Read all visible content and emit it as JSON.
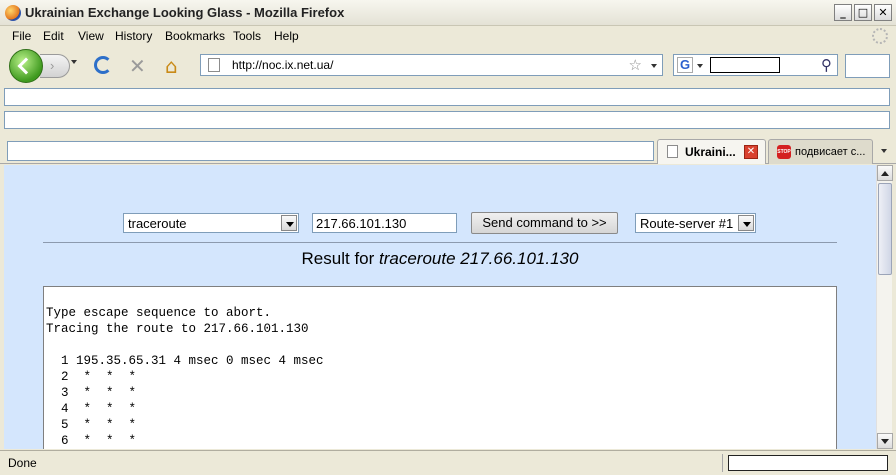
{
  "window": {
    "title": "Ukrainian Exchange Looking Glass - Mozilla Firefox",
    "buttons": {
      "minimize": "_",
      "maximize": "□",
      "close": "✕"
    }
  },
  "menu": [
    "File",
    "Edit",
    "View",
    "History",
    "Bookmarks",
    "Tools",
    "Help"
  ],
  "nav": {
    "forward_glyph": "›",
    "stop_glyph": "✕",
    "home_glyph": "⌂",
    "url": "http://noc.ix.net.ua/",
    "star_glyph": "☆",
    "search_engine": "G",
    "search_glyph": "⚲"
  },
  "tabs": [
    {
      "label": "Ukraini...",
      "close_glyph": "✕",
      "active": true
    },
    {
      "label": "подвисает с...",
      "icon_text": "STOP",
      "active": false
    }
  ],
  "form": {
    "command": "traceroute",
    "target": "217.66.101.130",
    "send_label": "Send command to >>",
    "server": "Route-server #1"
  },
  "result": {
    "prefix": "Result for ",
    "command": "traceroute 217.66.101.130",
    "output": "Type escape sequence to abort.\nTracing the route to 217.66.101.130\n\n  1 195.35.65.31 4 msec 0 msec 4 msec\n  2  *  *  *\n  3  *  *  *\n  4  *  *  *\n  5  *  *  *\n  6  *  *  *"
  },
  "status": {
    "text": "Done"
  }
}
